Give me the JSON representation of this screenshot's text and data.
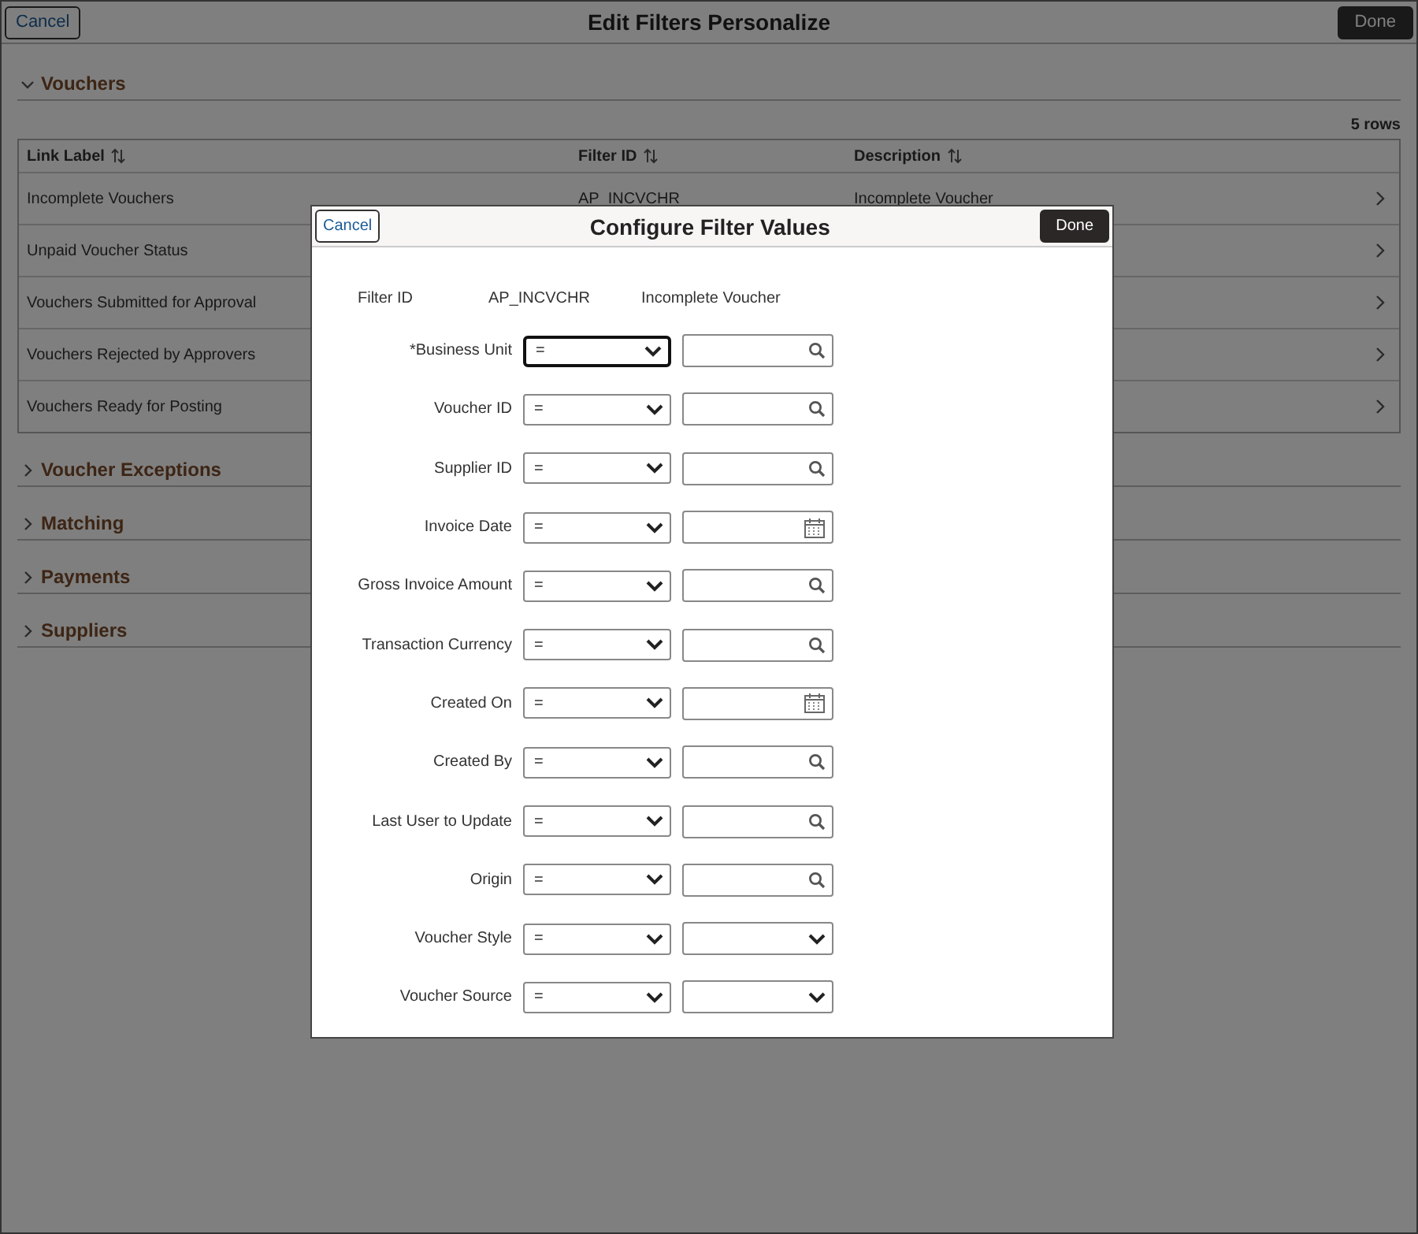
{
  "header": {
    "cancel": "Cancel",
    "title": "Edit Filters Personalize",
    "done": "Done"
  },
  "sections": [
    {
      "title": "Vouchers",
      "expanded": true,
      "row_count": "5 rows",
      "table": {
        "columns": [
          "Link Label",
          "Filter ID",
          "Description"
        ],
        "rows": [
          {
            "link_label": "Incomplete Vouchers",
            "filter_id": "AP_INCVCHR",
            "description": "Incomplete Voucher"
          },
          {
            "link_label": "Unpaid Voucher Status"
          },
          {
            "link_label": "Vouchers Submitted for Approval"
          },
          {
            "link_label": "Vouchers Rejected by Approvers"
          },
          {
            "link_label": "Vouchers Ready for Posting"
          }
        ]
      }
    },
    {
      "title": "Voucher Exceptions",
      "expanded": false
    },
    {
      "title": "Matching",
      "expanded": false
    },
    {
      "title": "Payments",
      "expanded": false
    },
    {
      "title": "Suppliers",
      "expanded": false
    }
  ],
  "dialog": {
    "cancel": "Cancel",
    "title": "Configure Filter Values",
    "done": "Done",
    "filter_label": "Filter ID",
    "filter_id": "AP_INCVCHR",
    "filter_description": "Incomplete Voucher",
    "fields": [
      {
        "label": "*Business Unit",
        "operator": "=",
        "kind": "search",
        "focused": true
      },
      {
        "label": "Voucher ID",
        "operator": "=",
        "kind": "search",
        "focused": false
      },
      {
        "label": "Supplier ID",
        "operator": "=",
        "kind": "search",
        "focused": false
      },
      {
        "label": "Invoice Date",
        "operator": "=",
        "kind": "calendar",
        "focused": false
      },
      {
        "label": "Gross Invoice Amount",
        "operator": "=",
        "kind": "search",
        "focused": false
      },
      {
        "label": "Transaction Currency",
        "operator": "=",
        "kind": "search",
        "focused": false
      },
      {
        "label": "Created On",
        "operator": "=",
        "kind": "calendar",
        "focused": false
      },
      {
        "label": "Created By",
        "operator": "=",
        "kind": "search",
        "focused": false
      },
      {
        "label": "Last User to Update",
        "operator": "=",
        "kind": "search",
        "focused": false
      },
      {
        "label": "Origin",
        "operator": "=",
        "kind": "search",
        "focused": false
      },
      {
        "label": "Voucher Style",
        "operator": "=",
        "kind": "dropdown",
        "focused": false
      },
      {
        "label": "Voucher Source",
        "operator": "=",
        "kind": "dropdown",
        "focused": false
      }
    ]
  }
}
